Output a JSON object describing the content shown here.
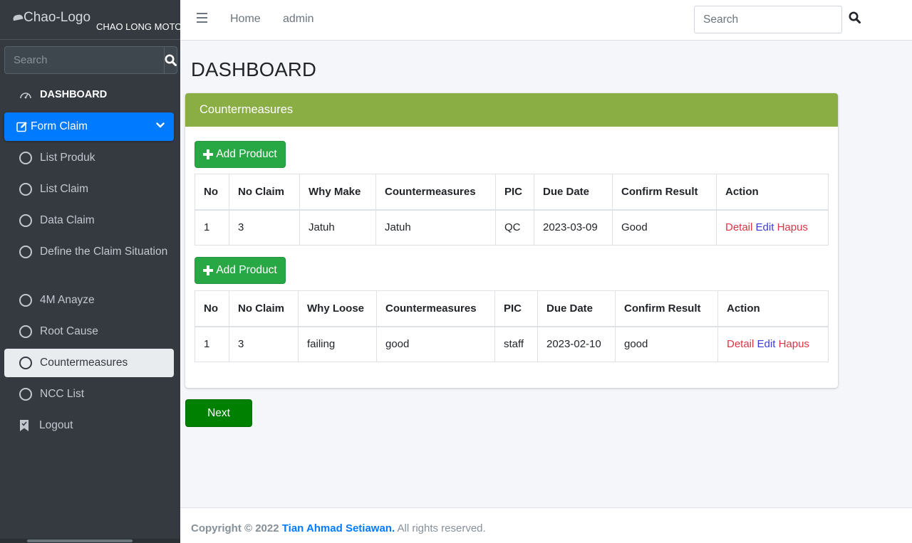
{
  "brand": {
    "logo_text": "Chao-Logo",
    "name": "CHAO LONG MOTOR"
  },
  "sidebar": {
    "search_placeholder": "Search",
    "dashboard_label": "DASHBOARD",
    "form_claim_label": "Form Claim",
    "items": [
      {
        "label": "List Produk"
      },
      {
        "label": "List Claim"
      },
      {
        "label": "Data Claim"
      },
      {
        "label": "Define the Claim Situation"
      },
      {
        "label": "4M Anayze"
      },
      {
        "label": "Root Cause"
      },
      {
        "label": "Countermeasures",
        "active": true
      },
      {
        "label": "NCC List"
      }
    ],
    "logout_label": "Logout"
  },
  "topbar": {
    "links": [
      "Home",
      "admin"
    ],
    "search_placeholder": "Search"
  },
  "page": {
    "title": "DASHBOARD"
  },
  "card": {
    "title": "Countermeasures",
    "add_button_label": "Add Product",
    "tables": [
      {
        "headers": [
          "No",
          "No Claim",
          "Why Make",
          "Countermeasures",
          "PIC",
          "Due Date",
          "Confirm Result",
          "Action"
        ],
        "rows": [
          {
            "no": "1",
            "no_claim": "3",
            "why": "Jatuh",
            "countermeasures": "Jatuh",
            "pic": "QC",
            "due_date": "2023-03-09",
            "confirm_result": "Good"
          }
        ]
      },
      {
        "headers": [
          "No",
          "No Claim",
          "Why Loose",
          "Countermeasures",
          "PIC",
          "Due Date",
          "Confirm Result",
          "Action"
        ],
        "rows": [
          {
            "no": "1",
            "no_claim": "3",
            "why": "failing",
            "countermeasures": "good",
            "pic": "staff",
            "due_date": "2023-02-10",
            "confirm_result": "good"
          }
        ]
      }
    ],
    "actions": {
      "detail": "Detail",
      "edit": "Edit",
      "hapus": "Hapus"
    }
  },
  "next_button_label": "Next",
  "footer": {
    "prefix": "Copyright © 2022",
    "author": "Tian Ahmad Setiawan.",
    "suffix": "All rights reserved."
  },
  "colors": {
    "sidebar_bg": "#343a40",
    "primary": "#007bff",
    "card_header": "#8aad44",
    "success": "#28a745",
    "next_button": "#008000",
    "danger": "#dc3545"
  }
}
